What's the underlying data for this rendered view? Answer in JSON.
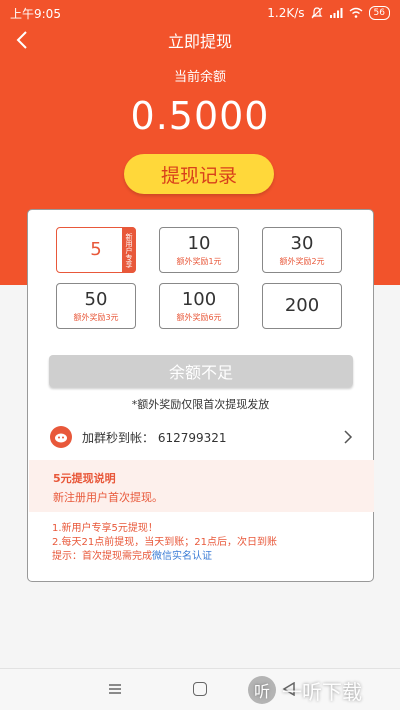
{
  "status_bar": {
    "time": "上午9:05",
    "speed": "1.2K/s",
    "battery": "56"
  },
  "nav": {
    "title": "立即提现"
  },
  "balance": {
    "label": "当前余额",
    "value": "0.5000"
  },
  "record_button": "提现记录",
  "options": [
    {
      "value": "5",
      "sub": "",
      "tag": "新用户专享",
      "selected": true
    },
    {
      "value": "10",
      "sub": "额外奖励1元",
      "tag": "",
      "selected": false
    },
    {
      "value": "30",
      "sub": "额外奖励2元",
      "tag": "",
      "selected": false
    },
    {
      "value": "50",
      "sub": "额外奖励3元",
      "tag": "",
      "selected": false
    },
    {
      "value": "100",
      "sub": "额外奖励6元",
      "tag": "",
      "selected": false
    },
    {
      "value": "200",
      "sub": "",
      "tag": "",
      "selected": false
    }
  ],
  "insufficient_button": "余额不足",
  "note": "*额外奖励仅限首次提现发放",
  "group": {
    "text": "加群秒到帐： 612799321"
  },
  "explain": {
    "title": "5元提现说明",
    "desc": "新注册用户首次提现。"
  },
  "rules": {
    "line1": "1.新用户专享5元提现！",
    "line2": "2.每天21点前提现，当天到账；21点后，次日到账",
    "line3_prefix": "提示：首次提现需完成",
    "line3_link": "微信实名认证"
  },
  "watermark": {
    "logo": "听",
    "text": "一听下载"
  },
  "colors": {
    "primary": "#f2532b",
    "accent": "#e8583a",
    "button": "#ffd83a",
    "link": "#3a7bd5"
  }
}
